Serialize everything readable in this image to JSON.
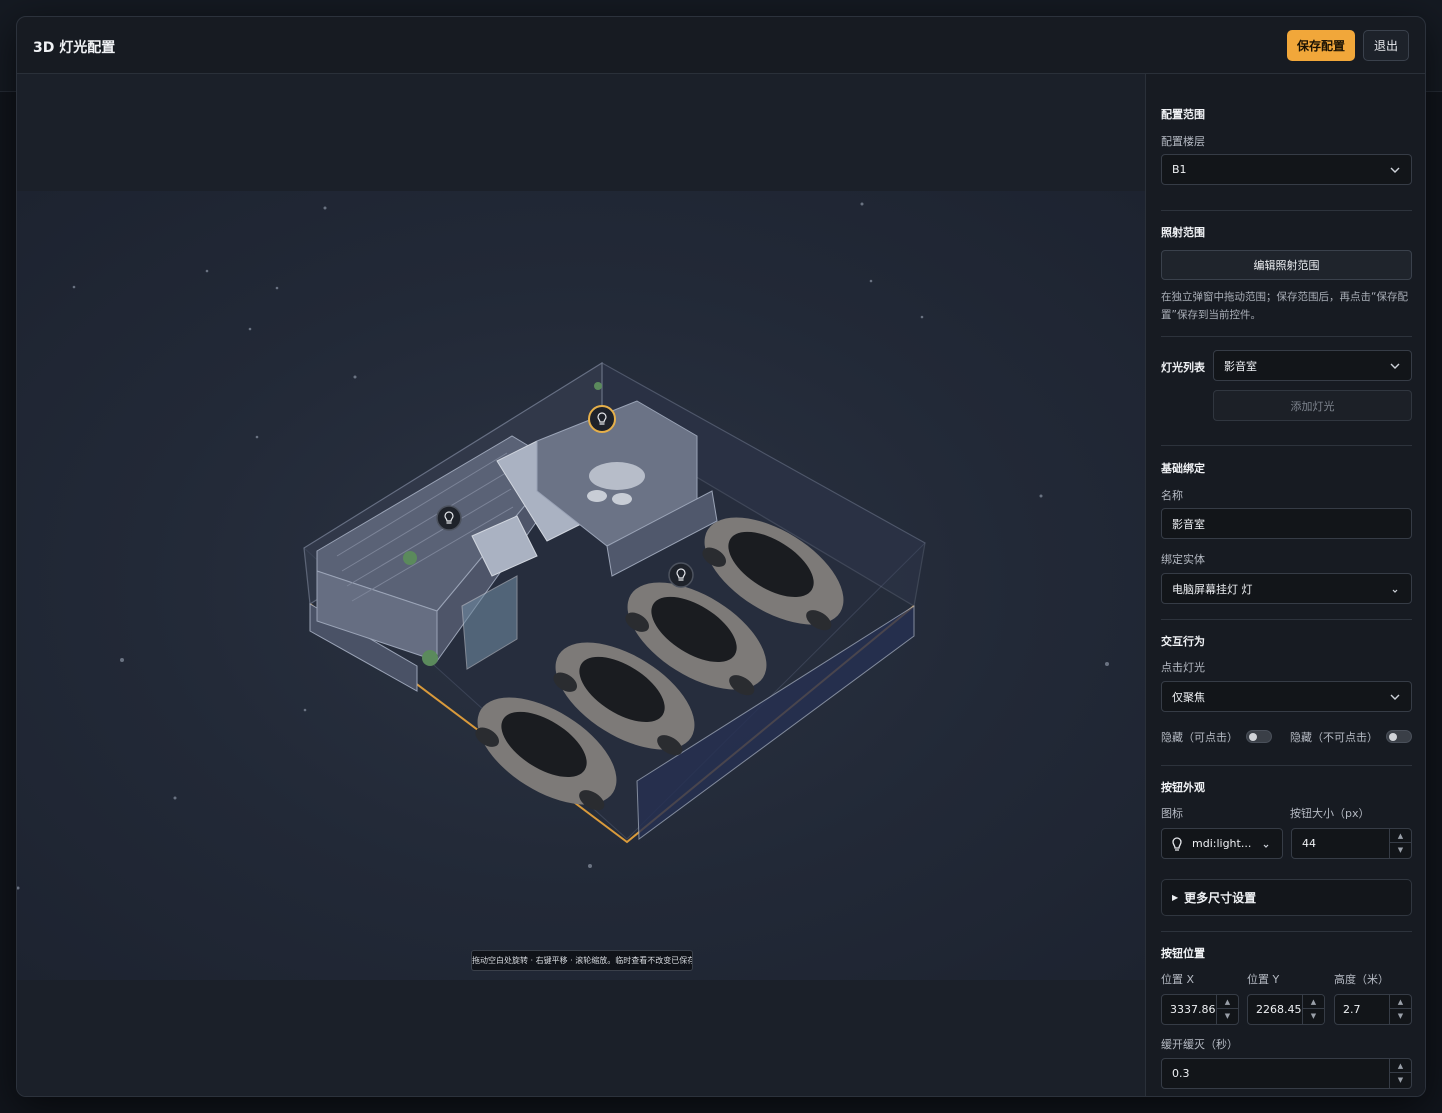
{
  "modal": {
    "title": "3D 灯光配置",
    "save_label": "保存配置",
    "exit_label": "退出"
  },
  "viewport": {
    "hint": "拖动空白处旋转 · 右键平移 · 滚轮缩放。临时查看不改变已保存视角。"
  },
  "panel": {
    "scope": {
      "title": "配置范围",
      "floor_label": "配置楼层",
      "floor_value": "B1"
    },
    "range": {
      "title": "照射范围",
      "edit_label": "编辑照射范围",
      "description": "在独立弹窗中拖动范围；保存范围后，再点击“保存配置”保存到当前控件。"
    },
    "lights": {
      "title": "灯光列表",
      "selected": "影音室",
      "add_label": "添加灯光"
    },
    "binding": {
      "title": "基础绑定",
      "name_label": "名称",
      "name_value": "影音室",
      "entity_label": "绑定实体",
      "entity_value": "电脑屏幕挂灯 灯"
    },
    "interaction": {
      "title": "交互行为",
      "click_label": "点击灯光",
      "click_value": "仅聚焦",
      "hide_clickable_label": "隐藏（可点击）",
      "hide_nonclickable_label": "隐藏（不可点击）"
    },
    "appearance": {
      "title": "按钮外观",
      "icon_label": "图标",
      "icon_value": "mdi:light...",
      "size_label": "按钮大小（px）",
      "size_value": "44",
      "more_label": "更多尺寸设置"
    },
    "position": {
      "title": "按钮位置",
      "x_label": "位置 X",
      "x_value": "3337.86",
      "y_label": "位置 Y",
      "y_value": "2268.45",
      "height_label": "高度（米）",
      "height_value": "2.7",
      "fade_label": "缓开缓灭（秒）",
      "fade_value": "0.3"
    }
  },
  "colors": {
    "accent": "#f1a73a",
    "panel_bg": "#171b22",
    "scene_bg": "#222937",
    "floor_outline": "#d99a3b"
  },
  "icons": [
    "chevron-down-icon",
    "light-bulb-icon",
    "triangle-right-icon"
  ]
}
